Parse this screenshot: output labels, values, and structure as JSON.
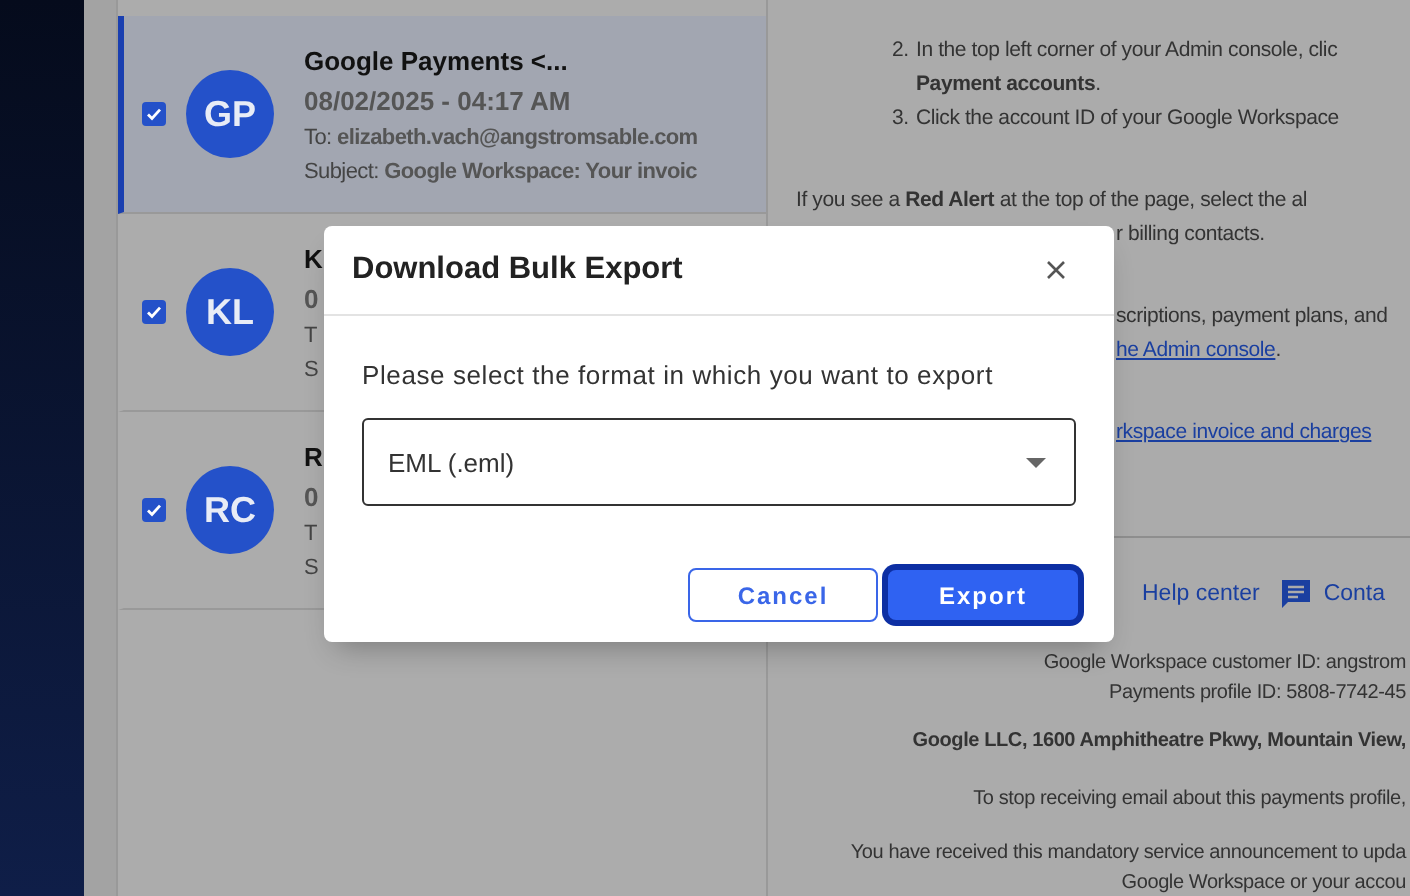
{
  "messages": [
    {
      "initials": "GP",
      "checked": true,
      "selected": true,
      "sender": "Google Payments <...",
      "date": "08/02/2025 - 04:17 AM",
      "to_label": "To:",
      "to": "elizabeth.vach@angstromsable.com",
      "subject_label": "Subject:",
      "subject": "Google Workspace: Your invoic"
    },
    {
      "initials": "KL",
      "checked": true,
      "selected": false,
      "sender": "K",
      "date": "0",
      "to_label": "T",
      "subject_label": "S"
    },
    {
      "initials": "RC",
      "checked": true,
      "selected": false,
      "sender": "R",
      "date": "0",
      "to_label": "T",
      "subject_label": "S"
    }
  ],
  "reading_pane": {
    "blocks": [
      {
        "kind": "list",
        "items": [
          {
            "number": "2.",
            "lines": [
              "In the top left corner of your Admin console, clic",
              "**Payment accounts**."
            ]
          },
          {
            "number": "3.",
            "lines": [
              "Click the account ID of your Google Workspace"
            ]
          }
        ]
      },
      {
        "kind": "paragraph",
        "lines": [
          {
            "kind": "full",
            "segments": [
              {
                "text": "If you see a **Red Alert** at the top of the page, select the al",
                "link": false
              }
            ]
          },
          {
            "kind": "partial",
            "segments": [
              {
                "text": "r billing contacts.",
                "link": false
              }
            ]
          }
        ]
      },
      {
        "kind": "paragraph",
        "lines": [
          {
            "kind": "partial",
            "segments": [
              {
                "text": "scriptions, payment plans, and",
                "link": false
              }
            ]
          },
          {
            "kind": "partial",
            "segments": [
              {
                "text": "he Admin console",
                "link": true
              },
              {
                "text": ".",
                "link": false
              }
            ]
          }
        ]
      },
      {
        "kind": "paragraph",
        "lines": [
          {
            "kind": "partial",
            "segments": [
              {
                "text": "rkspace invoice and charges",
                "link": true
              }
            ]
          }
        ]
      }
    ],
    "footer_links": [
      {
        "label": "Help center"
      },
      {
        "label": "Conta"
      }
    ],
    "footer_lines": [
      {
        "text": "Google Workspace customer ID: angstrom",
        "bold": false
      },
      {
        "text": "Payments profile ID: 5808-7742-45",
        "bold": false
      },
      {
        "text": "Google LLC, 1600 Amphitheatre Pkwy, Mountain View,",
        "bold": true
      },
      {
        "text": "To stop receiving email about this payments profile,",
        "bold": false
      },
      {
        "text": "You have received this mandatory service announcement to upda",
        "bold": false
      },
      {
        "text": "Google Workspace or your accou",
        "bold": false
      }
    ]
  },
  "dialog": {
    "title": "Download Bulk Export",
    "prompt": "Please select the format in which you want to export",
    "format_select": {
      "value": "EML (.eml)"
    },
    "buttons": [
      {
        "label": "Cancel",
        "kind": "secondary",
        "focused": false
      },
      {
        "label": "Export",
        "kind": "primary",
        "focused": true
      }
    ]
  }
}
